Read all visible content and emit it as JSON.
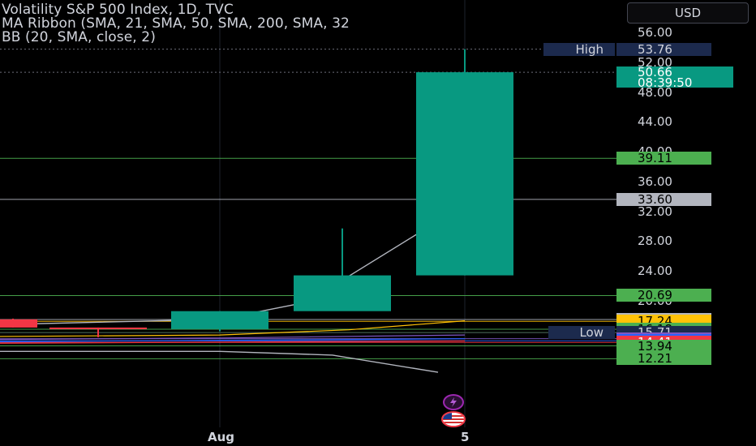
{
  "legend": {
    "line1": "Volatility S&P 500 Index, 1D, TVC",
    "line2": "MA Ribbon (SMA, 21, SMA, 50, SMA, 200, SMA, 32",
    "line3": "BB (20, SMA, close, 2)"
  },
  "currency_button": "USD",
  "colors": {
    "background": "#000000",
    "candle_up": "#089981",
    "candle_down": "#f23645",
    "grid": "#2a2e39"
  },
  "chart_data": {
    "type": "candlestick",
    "symbol": "Volatility S&P 500 Index",
    "interval": "1D",
    "source": "TVC",
    "x_axis_labels": [
      {
        "label": "Aug",
        "date": "2024-08-01"
      },
      {
        "label": "5",
        "date": "2024-08-05"
      }
    ],
    "y_axis": {
      "min": 10,
      "max": 57,
      "ticks": [
        56,
        52,
        48,
        44,
        40,
        36,
        32,
        28,
        24,
        20
      ],
      "tick_labels": [
        "56.00",
        "52.00",
        "48.00",
        "44.00",
        "40.00",
        "36.00",
        "32.00",
        "28.00",
        "24.00",
        "20.00"
      ]
    },
    "candles": [
      {
        "date": "2024-07-30",
        "open": 17.5,
        "high": 17.6,
        "low": 16.4,
        "close": 16.4
      },
      {
        "date": "2024-07-31",
        "open": 16.4,
        "high": 16.4,
        "low": 15.1,
        "close": 16.2
      },
      {
        "date": "2024-08-01",
        "open": 16.2,
        "high": 18.6,
        "low": 15.9,
        "close": 18.6
      },
      {
        "date": "2024-08-02",
        "open": 18.6,
        "high": 29.7,
        "low": 19.3,
        "close": 23.4
      },
      {
        "date": "2024-08-05",
        "open": 23.4,
        "high": 53.76,
        "low": 23.4,
        "close": 50.66
      }
    ],
    "price_lines": [
      {
        "value": 53.76,
        "label": "53.76",
        "name": "High",
        "color": "#131722",
        "dash": true
      },
      {
        "value": 50.66,
        "label": "50.66",
        "sub": "08:39:50",
        "color": "#089981",
        "dash": true
      },
      {
        "value": 39.11,
        "label": "39.11",
        "color": "#4caf50"
      },
      {
        "value": 33.6,
        "label": "33.60",
        "color": "#b2b5be"
      },
      {
        "value": 20.69,
        "label": "20.69",
        "color": "#4caf50"
      },
      {
        "value": 17.48,
        "label": "17.48",
        "color": "#b2b5be"
      },
      {
        "value": 17.24,
        "label": "17.24",
        "color": "#ffc107"
      },
      {
        "value": 16.18,
        "label": "16.18",
        "color": "#4caf50"
      },
      {
        "value": 15.72,
        "label": "15.72",
        "color": "#4caf50"
      },
      {
        "value": 15.71,
        "label": "15.71",
        "name": "Low",
        "color": "#131722"
      },
      {
        "value": 14.91,
        "label": "14.91",
        "color": "#7e57c2"
      },
      {
        "value": 14.62,
        "label": "14.62",
        "color": "#2962ff"
      },
      {
        "value": 14.41,
        "label": "14.41",
        "color": "#f23645"
      },
      {
        "value": 13.94,
        "label": "13.94",
        "color": "#4caf50"
      },
      {
        "value": 12.21,
        "label": "12.21",
        "color": "#4caf50"
      }
    ]
  }
}
